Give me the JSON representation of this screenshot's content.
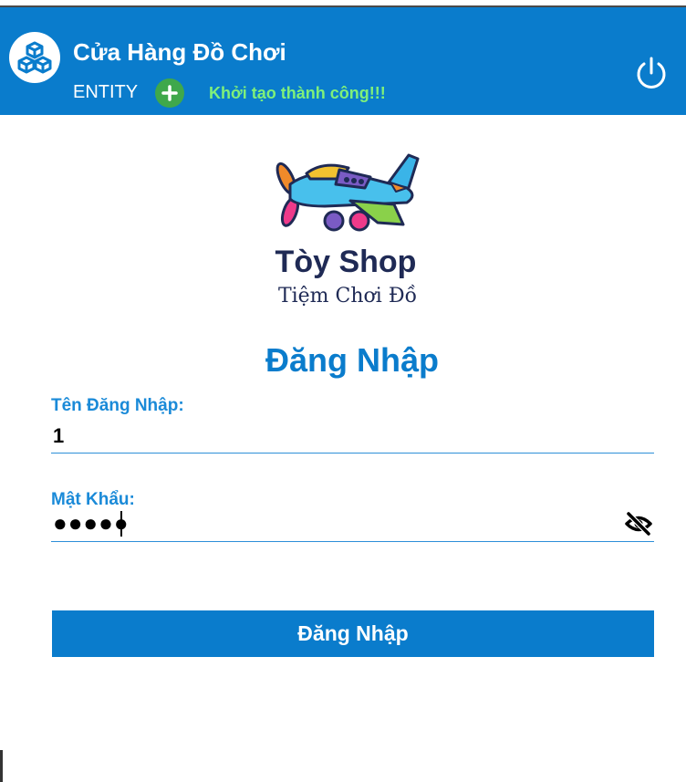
{
  "header": {
    "title": "Cửa Hàng Đồ Chơi",
    "entity_label": "ENTITY",
    "status_message": "Khởi tạo thành công!!!",
    "colors": {
      "bar": "#0a7ccc",
      "status": "#7ff07a",
      "add_button": "#3fa84b"
    }
  },
  "brand": {
    "name": "Tòy Shop",
    "subtitle": "Tiệm Chơi Đồ"
  },
  "form": {
    "title": "Đăng Nhập",
    "username_label": "Tên Đăng Nhập:",
    "username_value": "1",
    "password_label": "Mật Khẩu:",
    "password_masked": "●●●●●",
    "submit_label": "Đăng Nhập"
  },
  "icons": {
    "app": "cubes-icon",
    "add": "plus-icon",
    "power": "power-icon",
    "visibility": "eye-off-icon"
  }
}
